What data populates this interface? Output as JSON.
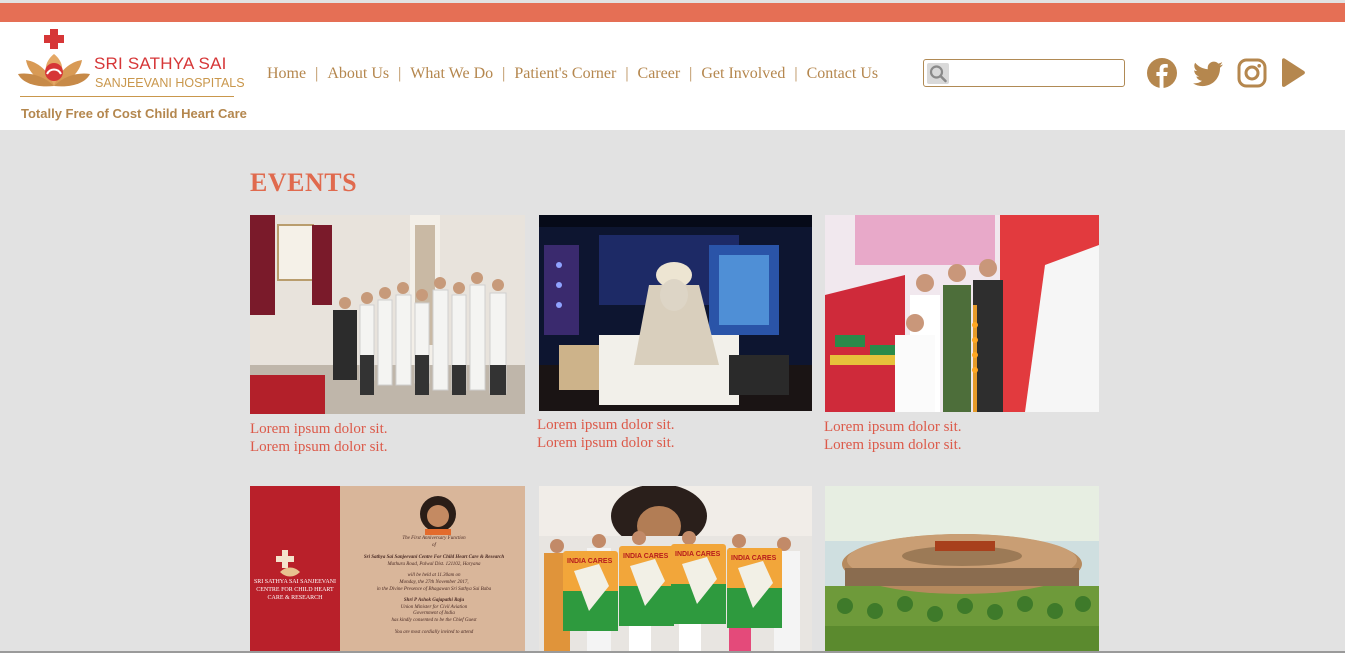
{
  "brand": {
    "name": "SRI SATHYA SAI",
    "subname": "SANJEEVANI HOSPITALS",
    "tagline": "Totally Free of Cost Child Heart Care"
  },
  "nav": {
    "items": [
      "Home",
      "About Us",
      "What We Do",
      "Patient's Corner",
      "Career",
      "Get Involved",
      "Contact Us"
    ],
    "separator": "|"
  },
  "search": {
    "placeholder": "",
    "value": ""
  },
  "social": [
    "facebook-icon",
    "twitter-icon",
    "instagram-icon",
    "youtube-icon"
  ],
  "colors": {
    "accent": "#e56f55",
    "gold": "#b5874e",
    "caption": "#dc5a4a",
    "brand_red": "#d63637",
    "background": "#e2e2e2"
  },
  "events": {
    "title": "EVENTS",
    "cards": [
      {
        "caption": [
          "Lorem ipsum dolor sit.",
          "Lorem ipsum dolor sit."
        ]
      },
      {
        "caption": [
          "Lorem ipsum dolor sit.",
          "Lorem ipsum dolor sit."
        ]
      },
      {
        "caption": [
          "Lorem ipsum dolor sit.",
          "Lorem ipsum dolor sit."
        ]
      },
      {
        "poster": {
          "left_title": "SRI SATHYA SAI SANJEEVANI CENTRE FOR CHILD HEART CARE & RESEARCH",
          "function": "The First Anniversary Function",
          "of": "of",
          "centre": "Sri Sathya Sai Sanjeevani Centre For Child Heart Care & Research",
          "address": "Mathura Road, Palwal Dist. 121102, Haryana",
          "time": "will be held at 11.30am on",
          "date": "Monday, the 27th November 2017,",
          "presence": "in the Divine Presence of Bhagawan Sri Sathya Sai Baba",
          "guest_name": "Shri P Ashok Gajapathi Raju",
          "guest_role": "Union Minister for Civil Aviation",
          "guest_govt": "Government of India",
          "guest_note": "has kindly consented to be the Chief Guest",
          "invite": "You are most cordially invited to attend"
        }
      },
      {
        "banner_text": "INDIA CARES"
      },
      {}
    ]
  }
}
